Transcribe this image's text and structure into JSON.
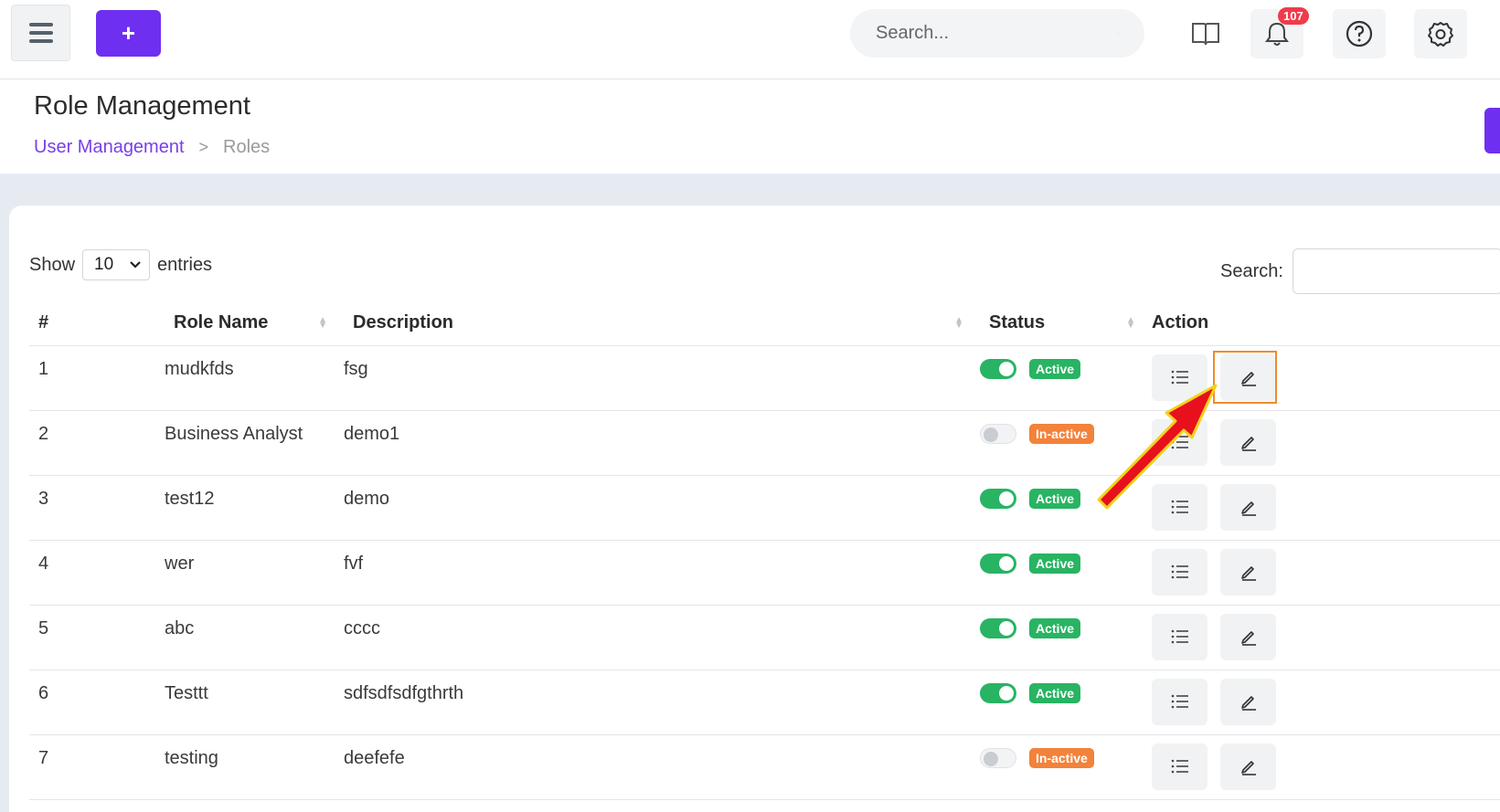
{
  "header": {
    "search_placeholder": "Search...",
    "notification_count": "107",
    "icons": [
      "menu-icon",
      "plus-icon",
      "search-icon",
      "book-icon",
      "bell-icon",
      "help-icon",
      "settings-icon"
    ]
  },
  "page": {
    "title": "Role Management",
    "breadcrumb": {
      "parent": "User Management",
      "separator": ">",
      "current": "Roles"
    }
  },
  "table_controls": {
    "show_label": "Show",
    "entries_value": "10",
    "entries_label": "entries",
    "search_label": "Search:"
  },
  "table": {
    "columns": [
      "#",
      "Role Name",
      "Description",
      "Status",
      "Action"
    ],
    "rows": [
      {
        "num": "1",
        "role": "mudkfds",
        "desc": "fsg",
        "enabled": true,
        "status": "Active"
      },
      {
        "num": "2",
        "role": "Business Analyst",
        "desc": "demo1",
        "enabled": false,
        "status": "In-active"
      },
      {
        "num": "3",
        "role": "test12",
        "desc": "demo",
        "enabled": true,
        "status": "Active"
      },
      {
        "num": "4",
        "role": "wer",
        "desc": "fvf",
        "enabled": true,
        "status": "Active"
      },
      {
        "num": "5",
        "role": "abc",
        "desc": "cccc",
        "enabled": true,
        "status": "Active"
      },
      {
        "num": "6",
        "role": "Testtt",
        "desc": "sdfsdfsdfgthrth",
        "enabled": true,
        "status": "Active"
      },
      {
        "num": "7",
        "role": "testing",
        "desc": "deefefe",
        "enabled": false,
        "status": "In-active"
      }
    ]
  },
  "colors": {
    "brand": "#6f2ff0",
    "active": "#28b463",
    "inactive": "#f3823a",
    "highlight": "#ef8b2b",
    "arrow": "#e8101c"
  }
}
